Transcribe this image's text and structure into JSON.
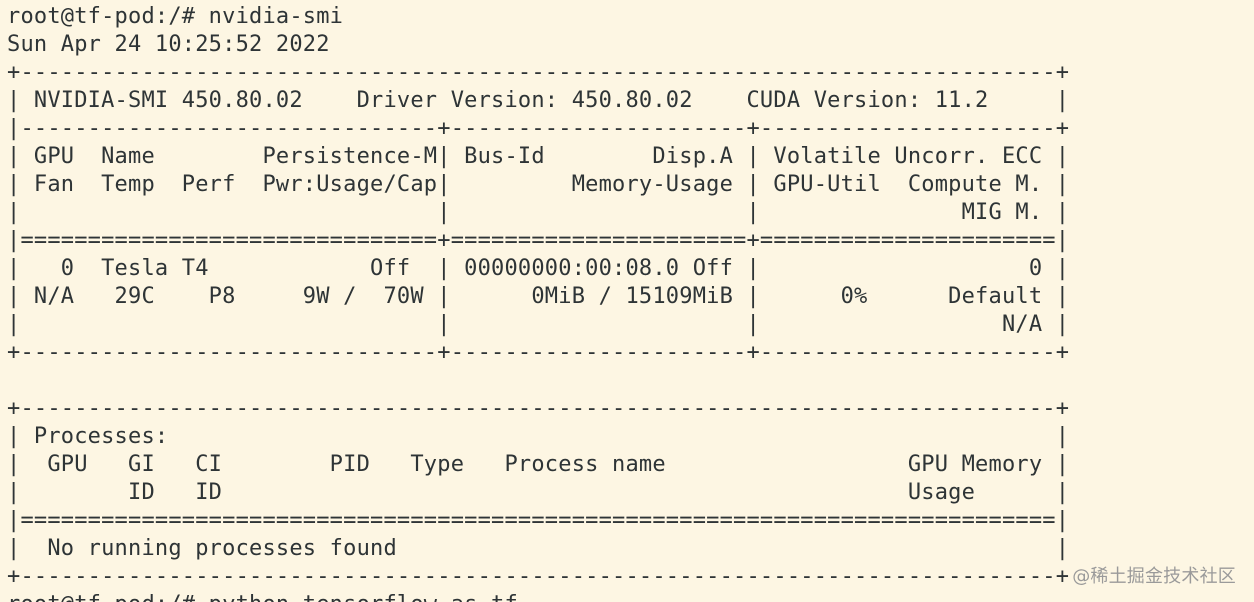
{
  "terminal": {
    "lines": [
      "root@tf-pod:/# nvidia-smi",
      "Sun Apr 24 10:25:52 2022",
      "+-----------------------------------------------------------------------------+",
      "| NVIDIA-SMI 450.80.02    Driver Version: 450.80.02    CUDA Version: 11.2     |",
      "|-------------------------------+----------------------+----------------------+",
      "| GPU  Name        Persistence-M| Bus-Id        Disp.A | Volatile Uncorr. ECC |",
      "| Fan  Temp  Perf  Pwr:Usage/Cap|         Memory-Usage | GPU-Util  Compute M. |",
      "|                               |                      |               MIG M. |",
      "|===============================+======================+======================|",
      "|   0  Tesla T4            Off  | 00000000:00:08.0 Off |                    0 |",
      "| N/A   29C    P8     9W /  70W |      0MiB / 15109MiB |      0%      Default |",
      "|                               |                      |                  N/A |",
      "+-------------------------------+----------------------+----------------------+",
      "",
      "+-----------------------------------------------------------------------------+",
      "| Processes:                                                                  |",
      "|  GPU   GI   CI        PID   Type   Process name                  GPU Memory |",
      "|        ID   ID                                                   Usage      |",
      "|=============================================================================|",
      "|  No running processes found                                                 |",
      "+-----------------------------------------------------------------------------+",
      "root@tf-pod:/# python tensorflow-as-tf"
    ],
    "background_color": "#fdf6e3",
    "text_color": "#2e3436"
  },
  "watermark": {
    "text": "@稀土掘金技术社区"
  }
}
